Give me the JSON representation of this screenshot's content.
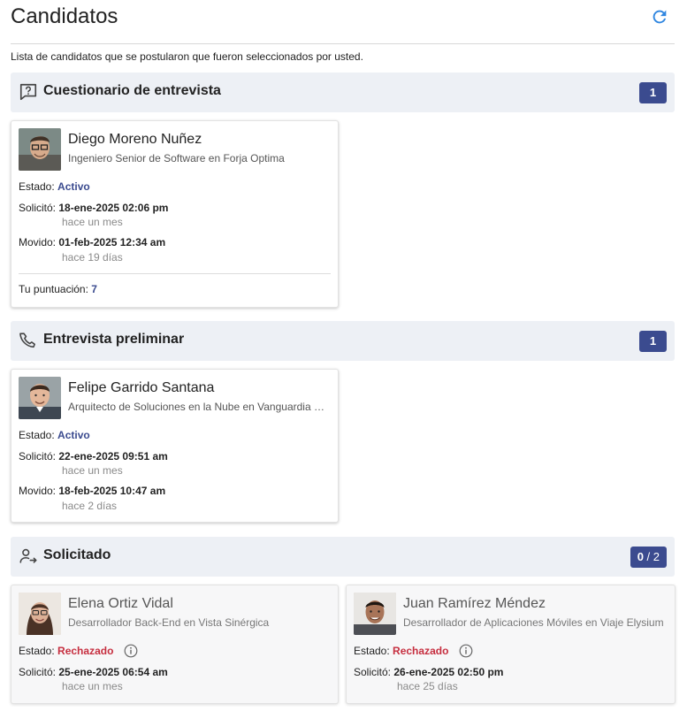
{
  "header": {
    "title": "Candidatos",
    "refresh_icon": "refresh-icon"
  },
  "subtitle": "Lista de candidatos que se postularon que fueron seleccionados por usted.",
  "labels": {
    "estado": "Estado:",
    "solicito": "Solicitó:",
    "movido": "Movido:",
    "puntuacion": "Tu puntuación:"
  },
  "colors": {
    "accent": "#3b4b8f",
    "rejected": "#c62e3f",
    "section_bg": "#edf0f5"
  },
  "sections": [
    {
      "title": "Cuestionario de entrevista",
      "icon": "question-chat-icon",
      "badge": "1",
      "candidates": [
        {
          "name": "Diego Moreno Nuñez",
          "role": "Ingeniero Senior de Software en Forja Optima",
          "status": "Activo",
          "applied": "18-ene-2025 02:06 pm",
          "applied_rel": "hace un mes",
          "moved": "01-feb-2025 12:34 am",
          "moved_rel": "hace 19 días",
          "score": "7"
        }
      ]
    },
    {
      "title": "Entrevista preliminar",
      "icon": "phone-icon",
      "badge": "1",
      "candidates": [
        {
          "name": "Felipe Garrido Santana",
          "role": "Arquitecto de Soluciones en la Nube en Vanguardia Digital",
          "status": "Activo",
          "applied": "22-ene-2025 09:51 am",
          "applied_rel": "hace un mes",
          "moved": "18-feb-2025 10:47 am",
          "moved_rel": "hace 2 días"
        }
      ]
    },
    {
      "title": "Solicitado",
      "icon": "person-arrow-icon",
      "badge_count": "0",
      "badge_sep": " / ",
      "badge_total": "2",
      "candidates": [
        {
          "name": "Elena Ortiz Vidal",
          "role": "Desarrollador Back-End en Vista Sinérgica",
          "status": "Rechazado",
          "applied": "25-ene-2025 06:54 am",
          "applied_rel": "hace un mes"
        },
        {
          "name": "Juan Ramírez Méndez",
          "role": "Desarrollador de Aplicaciones Móviles en Viaje Elysium",
          "status": "Rechazado",
          "applied": "26-ene-2025 02:50 pm",
          "applied_rel": "hace 25 días"
        }
      ]
    }
  ]
}
